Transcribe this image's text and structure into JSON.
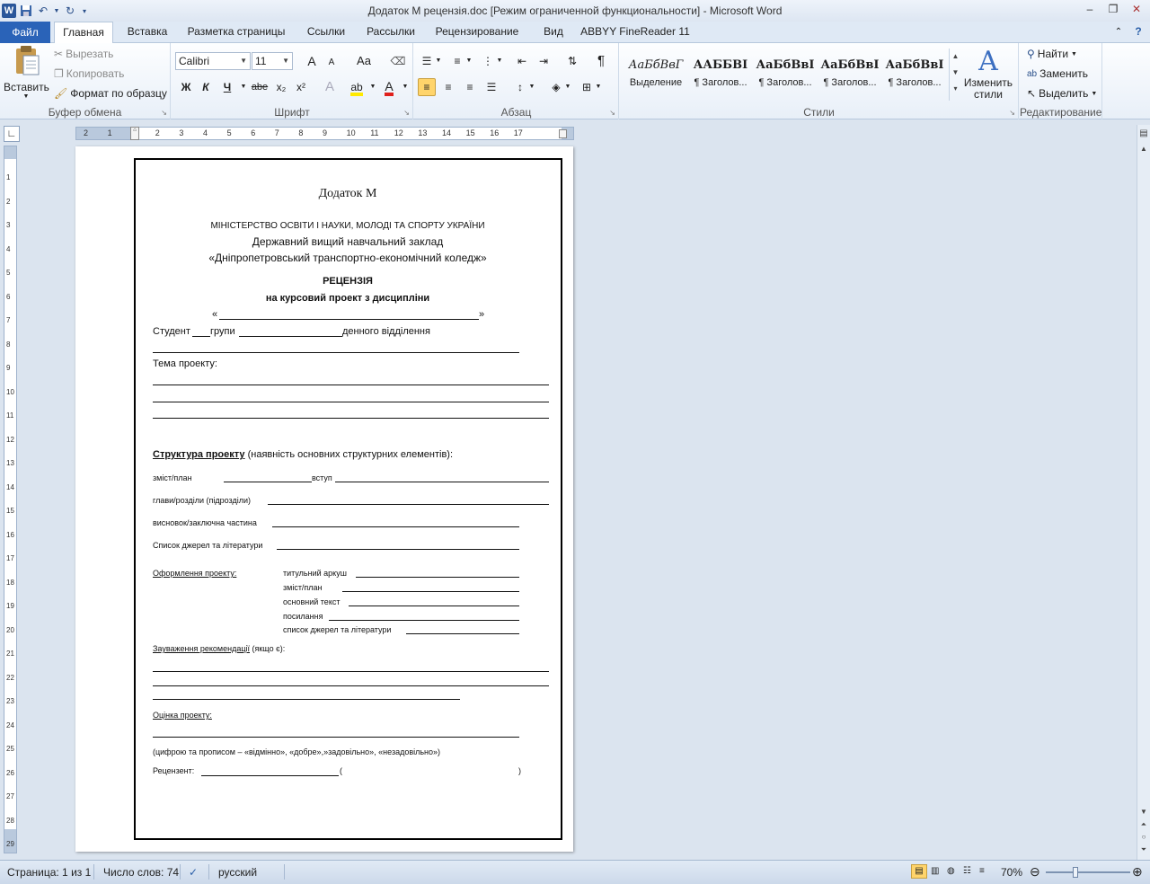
{
  "app": {
    "window_title": "Додаток М рецензія.doc [Режим ограниченной функциональности]  -  Microsoft Word",
    "window_buttons": [
      "–",
      "❐",
      "✕"
    ],
    "window_buttons_small": [
      "–",
      "❐",
      "✕"
    ]
  },
  "tabs": [
    "Файл",
    "Главная",
    "Вставка",
    "Разметка страницы",
    "Ссылки",
    "Рассылки",
    "Рецензирование",
    "Вид",
    "ABBYY FineReader 11"
  ],
  "ribbon": {
    "clipboard": {
      "label": "Буфер обмена",
      "paste": "Вставить",
      "cut": "Вырезать",
      "copy": "Копировать",
      "format_painter": "Формат по образцу"
    },
    "font": {
      "label": "Шрифт",
      "font_name": "Calibri",
      "font_size": "11",
      "bold": "Ж",
      "italic": "К",
      "underline": "Ч",
      "strike": "abe",
      "sub": "x₂",
      "sup": "x²",
      "case": "Aa",
      "grow": "A",
      "shrink": "A"
    },
    "paragraph": {
      "label": "Абзац",
      "pilcrow": "¶"
    },
    "styles": {
      "label": "Стили",
      "items": [
        {
          "preview": "АаБбВвГ",
          "name": "Выделение"
        },
        {
          "preview": "ААББВІ",
          "name": "¶ Заголов..."
        },
        {
          "preview": "АаБбВвІ",
          "name": "¶ Заголов..."
        },
        {
          "preview": "АаБбВвІ",
          "name": "¶ Заголов..."
        },
        {
          "preview": "АаБбВвІ",
          "name": "¶ Заголов..."
        }
      ],
      "change_styles": "Изменить стили"
    },
    "editing": {
      "label": "Редактирование",
      "find": "Найти",
      "replace": "Заменить",
      "select": "Выделить"
    }
  },
  "ruler": {
    "h_labels": [
      "2",
      "1",
      "1",
      "2",
      "3",
      "4",
      "5",
      "6",
      "7",
      "8",
      "9",
      "10",
      "11",
      "12",
      "13",
      "14",
      "15",
      "16",
      "17"
    ],
    "v_labels": [
      "1",
      "2",
      "3",
      "4",
      "5",
      "6",
      "7",
      "8",
      "9",
      "10",
      "11",
      "12",
      "13",
      "14",
      "15",
      "16",
      "17",
      "18",
      "19",
      "20",
      "21",
      "22",
      "23",
      "24",
      "25",
      "26",
      "27",
      "28",
      "29"
    ]
  },
  "document": {
    "appendix": "Додаток М",
    "ministry": "МІНІСТЕРСТВО ОСВІТИ І НАУКИ, МОЛОДІ ТА СПОРТУ УКРАЇНИ",
    "institution1": "Державний вищий навчальний заклад",
    "institution2": "«Дніпропетровський транспортно-економічний коледж»",
    "title": "РЕЦЕНЗІЯ",
    "subtitle": "на курсовий  проект з дисципліни",
    "quote_open": "«",
    "quote_close": "»",
    "student": "Студент",
    "group": "групи",
    "dept": "денного відділення",
    "topic": "Тема проекту:",
    "structure_title": "Структура проекту",
    "structure_note": " (наявність основних структурних елементів):",
    "contents": "зміст/план",
    "intro": "вступ",
    "chapters": "глави/розділи (підрозділи)",
    "conclusion": "висновок/заключна  частина",
    "references": "Список джерел та літератури",
    "design_title": "Оформлення проекту:",
    "design_items": [
      "титульний аркуш",
      "зміст/план",
      "основний текст",
      "посилання",
      "список джерел та літератури"
    ],
    "remarks_title": "Зауваження рекомендації",
    "remarks_note": " (якщо  є):",
    "grade_title": "Оцінка проекту:",
    "grade_note": "(цифрою та прописом – «відмінно», «добре»,»задовільно», «незадовільно»)",
    "reviewer": "Рецензент:",
    "paren_open": "(",
    "paren_close": ")"
  },
  "status": {
    "page": "Страница: 1 из 1",
    "words": "Число слов: 74",
    "language": "русский",
    "zoom": "70%",
    "zoom_fraction": 0.7
  }
}
